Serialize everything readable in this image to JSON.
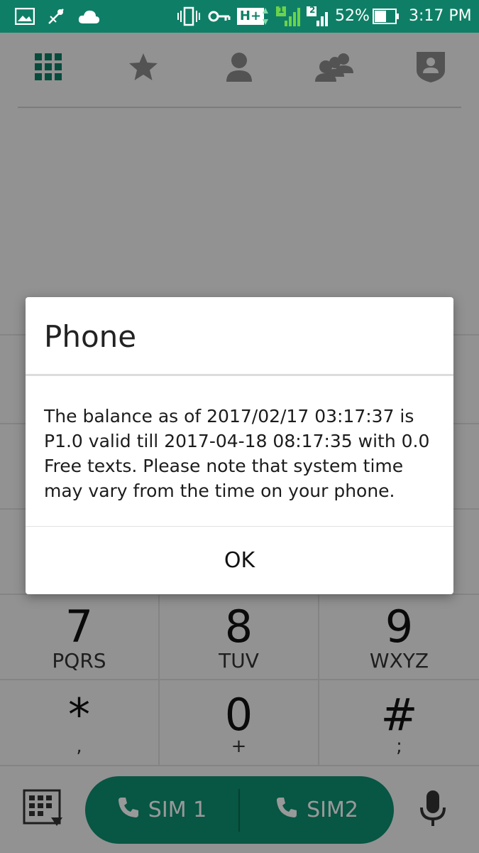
{
  "status_bar": {
    "battery_percent": "52%",
    "time": "3:17 PM",
    "network_type": "H+",
    "sim1_label": "1",
    "sim2_label": "2",
    "icons": [
      "gallery-icon",
      "usb-debug-icon",
      "cloud-icon",
      "vibrate-icon",
      "vpn-key-icon",
      "network-type-icon",
      "signal-icon",
      "signal-icon",
      "battery-icon"
    ]
  },
  "tabs": [
    {
      "name": "dialpad",
      "icon": "dialpad-icon",
      "active": true
    },
    {
      "name": "favorites",
      "icon": "star-icon",
      "active": false
    },
    {
      "name": "contacts",
      "icon": "person-icon",
      "active": false
    },
    {
      "name": "groups",
      "icon": "group-icon",
      "active": false
    },
    {
      "name": "blocked",
      "icon": "shield-person-icon",
      "active": false
    }
  ],
  "dialpad": {
    "row_7": [
      {
        "digit": "7",
        "letters": "PQRS"
      },
      {
        "digit": "8",
        "letters": "TUV"
      },
      {
        "digit": "9",
        "letters": "WXYZ"
      }
    ],
    "row_0": [
      {
        "digit": "*",
        "sub": ","
      },
      {
        "digit": "0",
        "sub": "+"
      },
      {
        "digit": "#",
        "sub": ";"
      }
    ]
  },
  "bottom_bar": {
    "sim1_label": "SIM 1",
    "sim2_label": "SIM2"
  },
  "dialog": {
    "title": "Phone",
    "message": "The balance as of 2017/02/17 03:17:37 is P1.0 valid till 2017-04-18 08:17:35 with 0.0 Free texts. Please note that system time may vary from the time on your phone.",
    "ok_label": "OK"
  },
  "colors": {
    "accent": "#0e7f66",
    "call_button": "#0e8f72"
  }
}
